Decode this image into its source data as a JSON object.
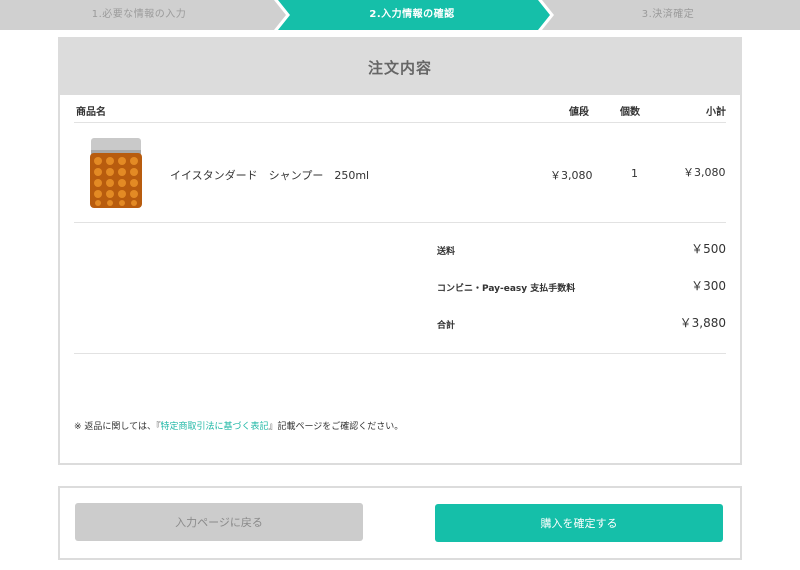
{
  "steps": [
    {
      "label": "1.必要な情報の入力",
      "state": "done"
    },
    {
      "label": "2.入力情報の確認",
      "state": "active"
    },
    {
      "label": "3.決済確定",
      "state": "upcoming"
    }
  ],
  "colors": {
    "accent": "#15bfa9",
    "step_inactive": "#d0d0d0",
    "header_bg": "#dcdcdc",
    "link": "#20b8a6"
  },
  "order": {
    "title": "注文内容",
    "columns": {
      "product": "商品名",
      "price": "値段",
      "quantity": "個数",
      "subtotal": "小計"
    },
    "items": [
      {
        "image_icon": "shampoo-bottle",
        "name": "イイスタンダード　シャンプー　250ml",
        "price": "￥3,080",
        "quantity": "1",
        "subtotal": "￥3,080"
      }
    ],
    "summary": {
      "shipping_label": "送料",
      "shipping_value": "￥500",
      "fee_label": "コンビニ・Pay-easy 支払手数料",
      "fee_value": "￥300",
      "total_label": "合計",
      "total_value": "￥3,880"
    },
    "note": {
      "prefix": "※ 返品に関しては、『",
      "link_text": "特定商取引法に基づく表記",
      "suffix": "』記載ページをご確認ください。"
    }
  },
  "actions": {
    "back_label": "入力ページに戻る",
    "confirm_label": "購入を確定する"
  }
}
